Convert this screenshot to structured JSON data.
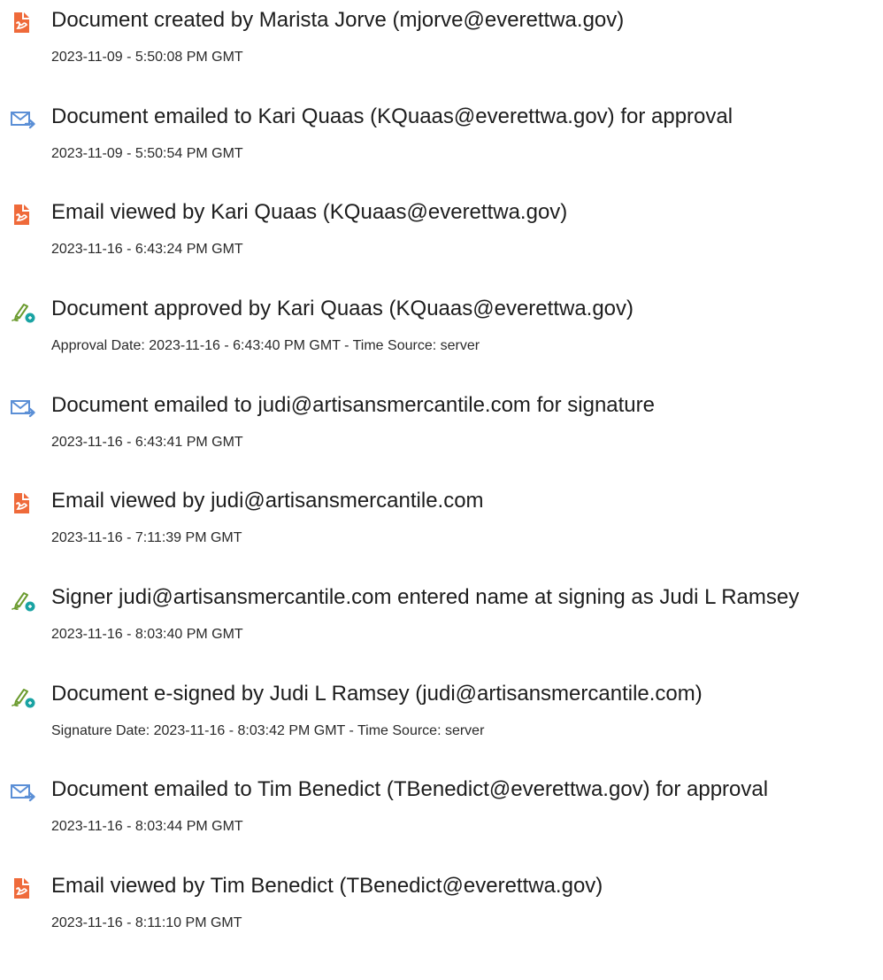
{
  "events": [
    {
      "icon": "document-icon",
      "text": "Document created by Marista Jorve (mjorve@everettwa.gov)",
      "detail": "2023-11-09 - 5:50:08 PM GMT"
    },
    {
      "icon": "email-sent-icon",
      "text": "Document emailed to Kari Quaas (KQuaas@everettwa.gov) for approval",
      "detail": "2023-11-09 - 5:50:54 PM GMT"
    },
    {
      "icon": "document-icon",
      "text": "Email viewed by Kari Quaas (KQuaas@everettwa.gov)",
      "detail": "2023-11-16 - 6:43:24 PM GMT"
    },
    {
      "icon": "signature-pen-icon",
      "text": "Document approved by Kari Quaas (KQuaas@everettwa.gov)",
      "detail": "Approval Date: 2023-11-16 - 6:43:40 PM GMT - Time Source: server"
    },
    {
      "icon": "email-sent-icon",
      "text": "Document emailed to judi@artisansmercantile.com for signature",
      "detail": "2023-11-16 - 6:43:41 PM GMT"
    },
    {
      "icon": "document-icon",
      "text": "Email viewed by judi@artisansmercantile.com",
      "detail": "2023-11-16 - 7:11:39 PM GMT"
    },
    {
      "icon": "signature-pen-icon",
      "text": "Signer judi@artisansmercantile.com entered name at signing as Judi L Ramsey",
      "detail": "2023-11-16 - 8:03:40 PM GMT"
    },
    {
      "icon": "signature-pen-icon",
      "text": "Document e-signed by Judi L Ramsey (judi@artisansmercantile.com)",
      "detail": "Signature Date: 2023-11-16 - 8:03:42 PM GMT - Time Source: server"
    },
    {
      "icon": "email-sent-icon",
      "text": "Document emailed to Tim Benedict (TBenedict@everettwa.gov) for approval",
      "detail": "2023-11-16 - 8:03:44 PM GMT"
    },
    {
      "icon": "document-icon",
      "text": "Email viewed by Tim Benedict (TBenedict@everettwa.gov)",
      "detail": "2023-11-16 - 8:11:10 PM GMT"
    }
  ],
  "colors": {
    "document_icon": "#ef6a3a",
    "email_icon": "#5b8fd6",
    "signature_icon": "#6b9b2f",
    "signature_badge": "#1aa3a3"
  }
}
